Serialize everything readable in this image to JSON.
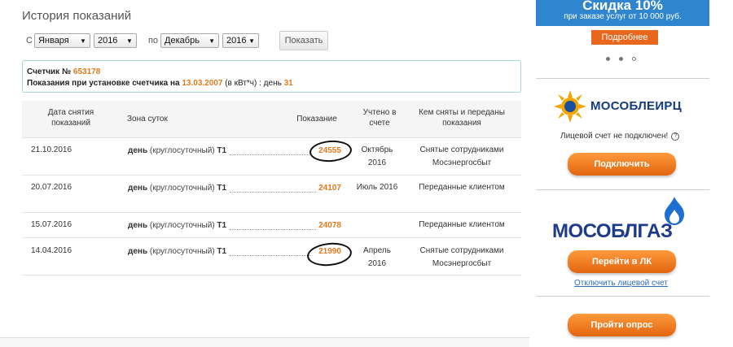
{
  "page": {
    "title": "История показаний"
  },
  "filter": {
    "from_label": "с",
    "from_month": "Января",
    "from_year": "2016",
    "to_label": "по",
    "to_month": "Декабрь",
    "to_year": "2016",
    "show_button": "Показать"
  },
  "meter_info": {
    "meter_label": "Счетчик №",
    "meter_number": "653178",
    "install_prefix": "Показания при установке счетчика на",
    "install_date": "13.03.2007",
    "install_unit": "(в кВт*ч) : день",
    "install_value": "31"
  },
  "table": {
    "headers": [
      "Дата снятия показаний",
      "Зона суток",
      "Показание",
      "Учтено в счете",
      "Кем сняты и переданы показания"
    ],
    "rows": [
      {
        "date": "21.10.2016",
        "zone_bold": "день",
        "zone_mid": "(круглосуточный)",
        "zone_tail": "Т1",
        "value": "24555",
        "accounted": "Октябрь 2016",
        "source": "Снятые сотрудниками Мосэнергосбыт"
      },
      {
        "date": "20.07.2016",
        "zone_bold": "день",
        "zone_mid": "(круглосуточный)",
        "zone_tail": "Т1",
        "value": "24107",
        "accounted": "Июль 2016",
        "source": "Переданные клиентом"
      },
      {
        "date": "15.07.2016",
        "zone_bold": "день",
        "zone_mid": "(круглосуточный)",
        "zone_tail": "Т1",
        "value": "24078",
        "accounted": "",
        "source": "Переданные клиентом"
      },
      {
        "date": "14.04.2016",
        "zone_bold": "день",
        "zone_mid": "(круглосуточный)",
        "zone_tail": "Т1",
        "value": "21990",
        "accounted": "Апрель 2016",
        "source": "Снятые сотрудниками Мосэнергосбыт"
      }
    ]
  },
  "sidebar": {
    "promo_title": "Скидка 10%",
    "promo_sub": "при заказе услуг от 10 000 руб.",
    "promo_button": "Подробнее",
    "carousel_dots": 3,
    "eirc_name": "МОСОБЛЕИРЦ",
    "eirc_status": "Лицевой счет не подключен!",
    "eirc_button": "Подключить",
    "gaz_name": "МОСОБЛГАЗ",
    "gaz_button": "Перейти в ЛК",
    "gaz_unlink": "Отключить лицевой счет",
    "survey_button": "Пройти опрос"
  },
  "colors": {
    "accent_orange": "#e07a1f",
    "promo_blue": "#2f86cf",
    "button_orange": "#e2650f",
    "eirc_blue": "#133b82",
    "gaz_blue": "#1d3a8c"
  },
  "icons": [
    "chevron-down-icon",
    "question-icon",
    "eirc-sun-icon",
    "gas-flame-icon"
  ]
}
